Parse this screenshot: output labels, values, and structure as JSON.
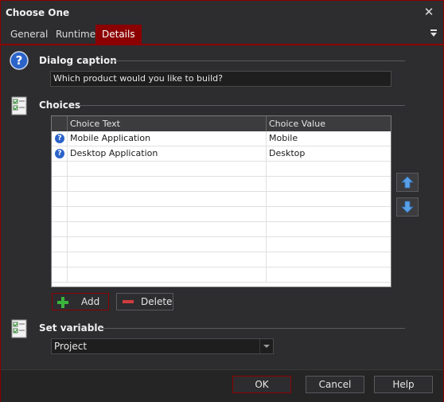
{
  "window": {
    "title": "Choose One"
  },
  "tabs": [
    {
      "label": "General"
    },
    {
      "label": "Runtime"
    },
    {
      "label": "Details",
      "active": true
    }
  ],
  "caption_section": {
    "heading": "Dialog caption",
    "value": "Which product would you like to build?"
  },
  "choices_section": {
    "heading": "Choices",
    "columns": [
      "Choice Text",
      "Choice Value"
    ],
    "rows": [
      {
        "text": "Mobile Application",
        "value": "Mobile"
      },
      {
        "text": "Desktop Application",
        "value": "Desktop"
      }
    ],
    "add_label": "Add",
    "delete_label": "Delete"
  },
  "variable_section": {
    "heading": "Set variable",
    "selected": "Project"
  },
  "footer": {
    "ok_label": "OK",
    "cancel_label": "Cancel",
    "help_label": "Help"
  },
  "colors": {
    "accent": "#8b0000",
    "background": "#2d2d30",
    "grid_background": "#ffffff",
    "question_icon": "#2b63c9",
    "add_icon": "#3cb43c",
    "delete_icon": "#d23c3c"
  }
}
